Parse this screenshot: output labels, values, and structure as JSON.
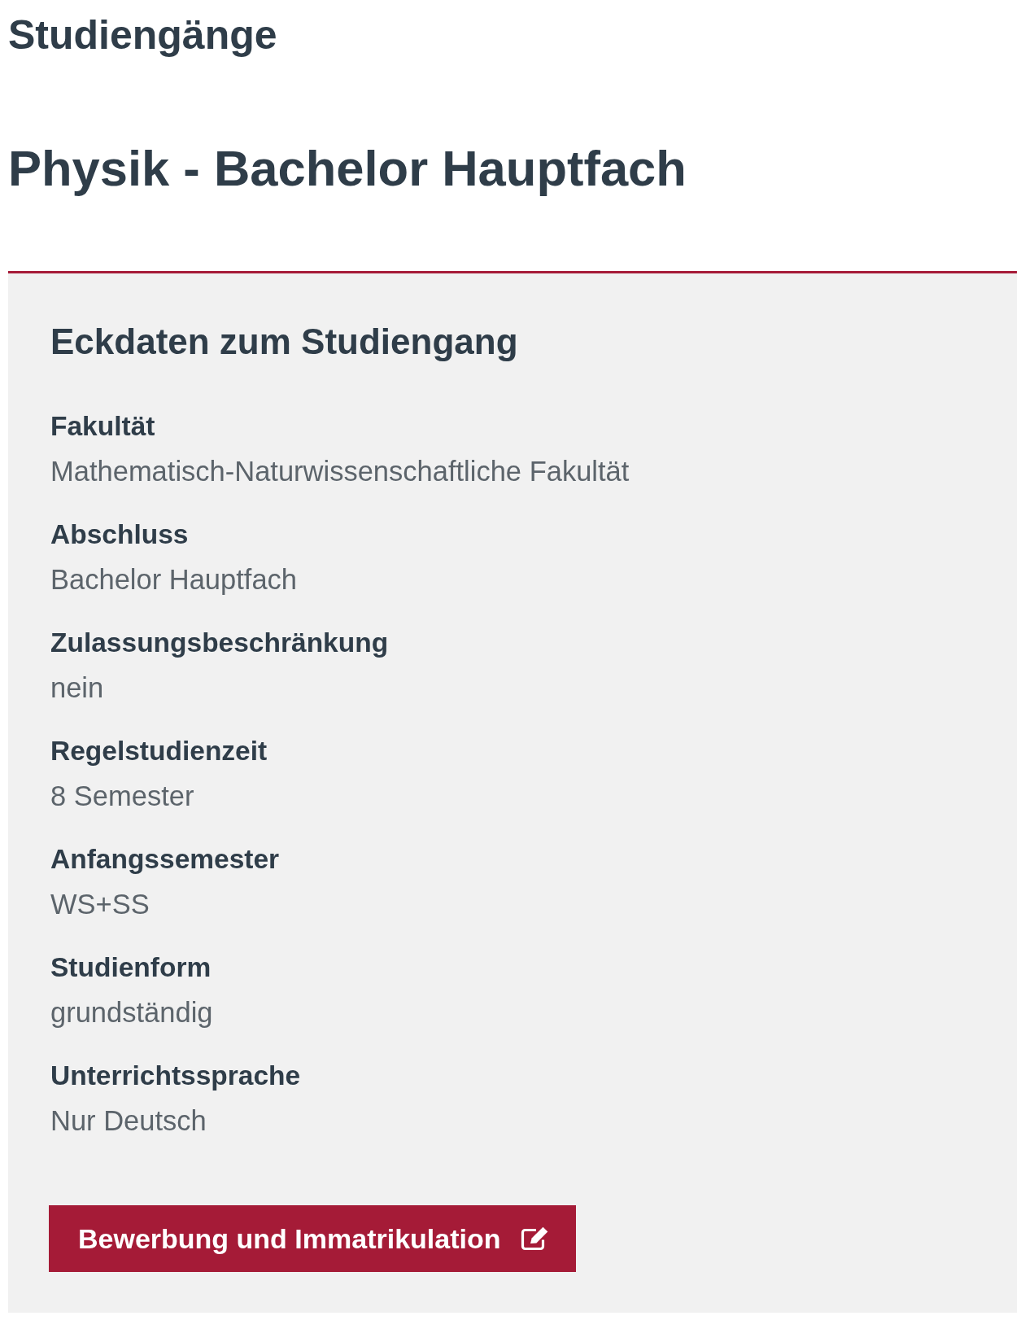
{
  "section_title": "Studiengänge",
  "title": "Physik - Bachelor Hauptfach",
  "panel": {
    "heading": "Eckdaten zum Studiengang",
    "facts": [
      {
        "label": "Fakultät",
        "value": "Mathematisch-Naturwissenschaftliche Fakultät"
      },
      {
        "label": "Abschluss",
        "value": "Bachelor Hauptfach"
      },
      {
        "label": "Zulassungsbeschränkung",
        "value": "nein"
      },
      {
        "label": "Regelstudienzeit",
        "value": "8 Semester"
      },
      {
        "label": "Anfangssemester",
        "value": "WS+SS"
      },
      {
        "label": "Studienform",
        "value": "grundständig"
      },
      {
        "label": "Unterrichtssprache",
        "value": "Nur Deutsch"
      }
    ],
    "button": {
      "label": "Bewerbung und Immatrikulation"
    }
  }
}
